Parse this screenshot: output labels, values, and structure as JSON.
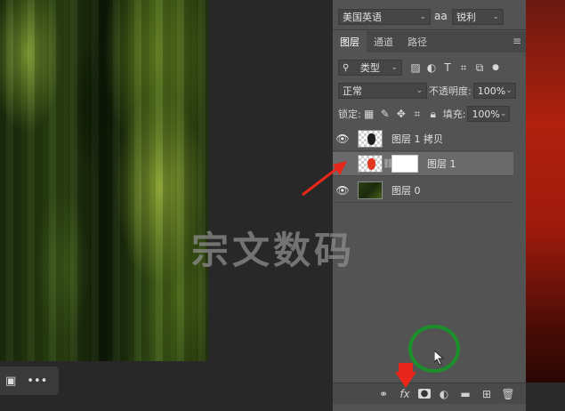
{
  "character": {
    "language": "美国英语",
    "aa_symbol": "aa",
    "antialias": "锐利"
  },
  "tabs": [
    {
      "label": "图层",
      "active": true
    },
    {
      "label": "通道",
      "active": false
    },
    {
      "label": "路径",
      "active": false
    }
  ],
  "filter": {
    "label": "类型"
  },
  "blend": {
    "mode": "正常",
    "opacity_label": "不透明度:",
    "opacity_value": "100%"
  },
  "lock": {
    "label": "锁定:",
    "fill_label": "填充:",
    "fill_value": "100%"
  },
  "layers": [
    {
      "name": "图层 1 拷贝",
      "thumb": "black-shape",
      "selected": false,
      "has_mask": false
    },
    {
      "name": "图层 1",
      "thumb": "red-shape",
      "selected": true,
      "has_mask": true
    },
    {
      "name": "图层 0",
      "thumb": "photo",
      "selected": false,
      "has_mask": false
    }
  ],
  "watermark": "宗文数码",
  "colors": {
    "annotation_arrow": "#e8261c",
    "annotation_circle": "#1b8f2a",
    "red_thumb": "#e3371f"
  }
}
